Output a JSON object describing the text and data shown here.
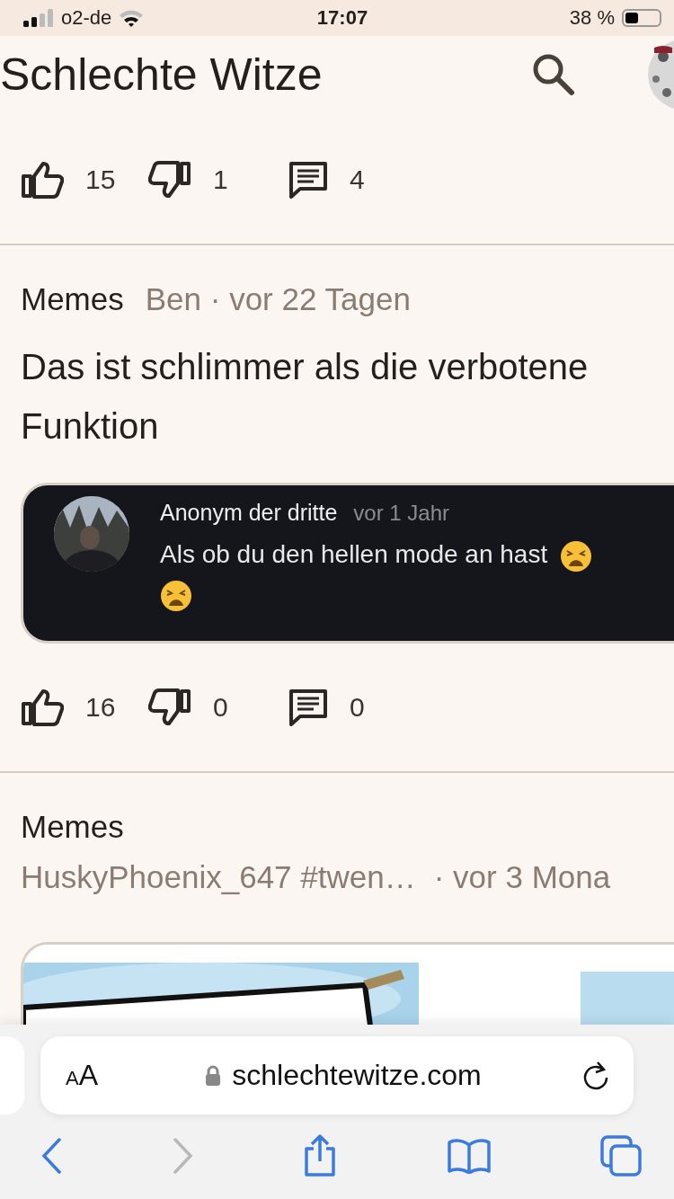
{
  "status_bar": {
    "carrier": "o2-de",
    "time": "17:07",
    "battery": "38 %"
  },
  "header": {
    "title": "Schlechte Witze"
  },
  "posts": [
    {
      "votes": {
        "likes": "15",
        "dislikes": "1",
        "comments": "4"
      }
    },
    {
      "category": "Memes",
      "meta": "Ben · vor 22 Tagen",
      "text": "Das ist schlimmer als die verbotene Funktion",
      "embed": {
        "author": "Anonym der dritte",
        "time": "vor 1 Jahr",
        "text": "Als ob du den hellen mode an hast",
        "emojis": [
          {
            "kind": "weary"
          },
          {
            "kind": "weary"
          }
        ]
      },
      "votes": {
        "likes": "16",
        "dislikes": "0",
        "comments": "0"
      }
    },
    {
      "category": "Memes",
      "author": "HuskyPhoenix_647 #twen…",
      "meta": "· vor 3 Mona"
    }
  ],
  "browser": {
    "reader_small": "A",
    "reader_large": "A",
    "url": "schlechtewitze.com",
    "back_disabled": false,
    "forward_disabled": true
  }
}
